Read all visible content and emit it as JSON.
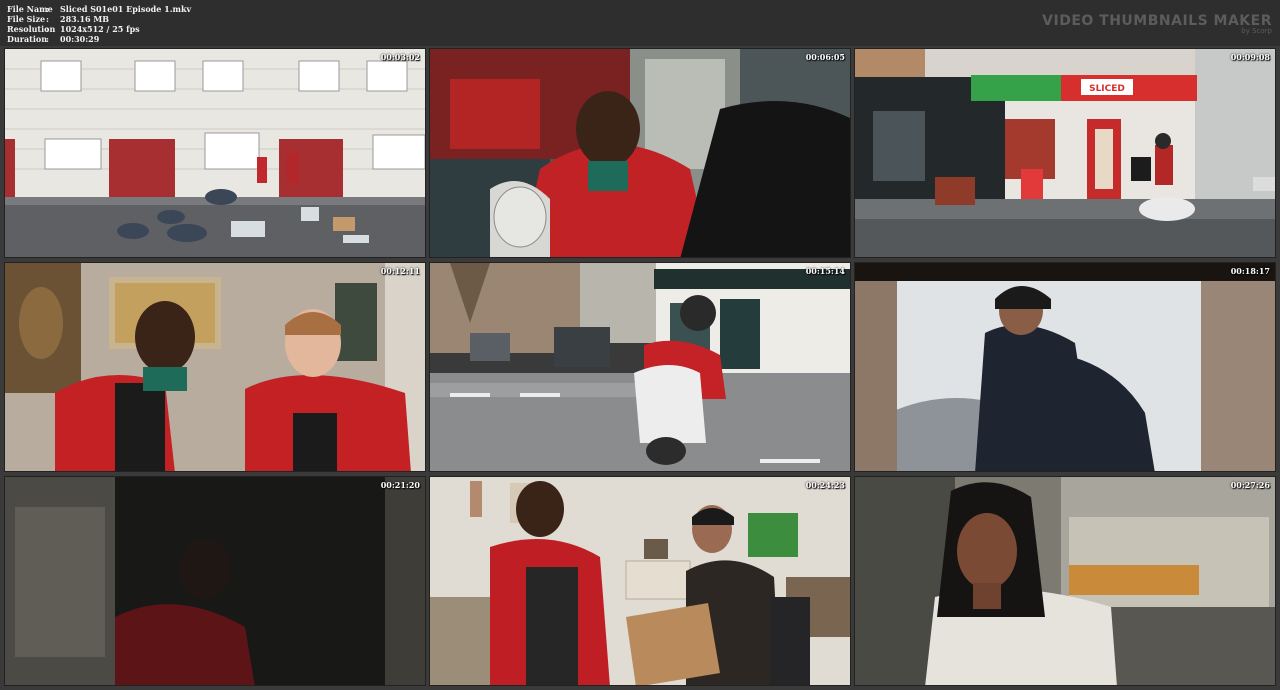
{
  "info": {
    "rows": [
      {
        "label": "File Name",
        "sep": ":",
        "value": "Sliced S01e01 Episode 1.mkv"
      },
      {
        "label": "File Size",
        "sep": ":",
        "value": "283.16 MB"
      },
      {
        "label": "Resolution",
        "sep": ":",
        "value": "1024x512 / 25 fps"
      },
      {
        "label": "Duration",
        "sep": ":",
        "value": "00:30:29"
      }
    ]
  },
  "brand": {
    "title": "VIDEO THUMBNAILS MAKER",
    "subtitle": "by Scorp"
  },
  "thumbnails": [
    {
      "timestamp": "00:03:02"
    },
    {
      "timestamp": "00:06:05"
    },
    {
      "timestamp": "00:09:08"
    },
    {
      "timestamp": "00:12:11"
    },
    {
      "timestamp": "00:15:14"
    },
    {
      "timestamp": "00:18:17"
    },
    {
      "timestamp": "00:21:20"
    },
    {
      "timestamp": "00:24:23"
    },
    {
      "timestamp": "00:27:26"
    }
  ],
  "scene_text": {
    "shop_sign": "SLICED"
  }
}
